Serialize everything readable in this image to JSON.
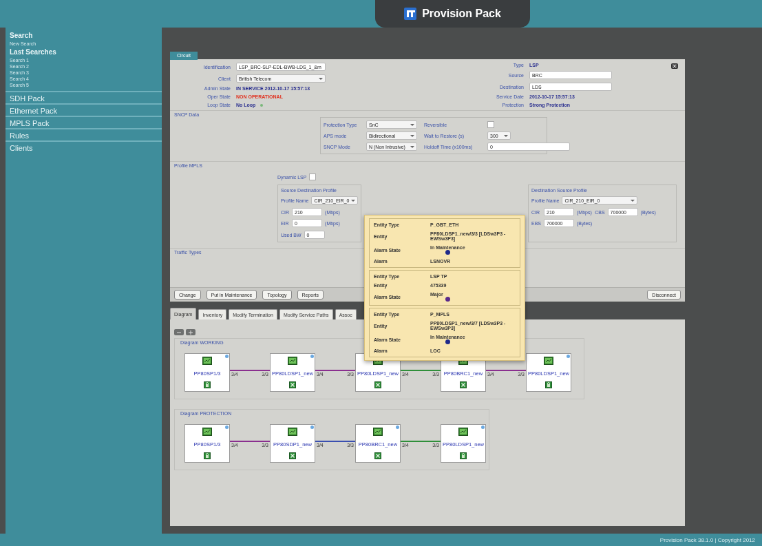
{
  "header": {
    "title": "Provision Pack"
  },
  "sidebar": {
    "items": [
      {
        "label": "Search",
        "kind": "heading"
      },
      {
        "label": "New Search",
        "kind": "link"
      },
      {
        "label": "Last Searches",
        "kind": "heading"
      },
      {
        "label": "Search 1",
        "kind": "link"
      },
      {
        "label": "Search 2",
        "kind": "link"
      },
      {
        "label": "Search 3",
        "kind": "link"
      },
      {
        "label": "Search 4",
        "kind": "link"
      },
      {
        "label": "Search 5",
        "kind": "link"
      },
      {
        "label": "SDH Pack",
        "kind": "section"
      },
      {
        "label": "Ethernet Pack",
        "kind": "section"
      },
      {
        "label": "MPLS Pack",
        "kind": "section"
      },
      {
        "label": "Rules",
        "kind": "section"
      },
      {
        "label": "Clients",
        "kind": "section"
      }
    ]
  },
  "circuit": {
    "tab": "Circuit",
    "left_fields": [
      {
        "label": "Identification",
        "kind": "input",
        "value": "LSP_BRC-SLP-EDL-BWB-LDS_1_&m"
      },
      {
        "label": "Client",
        "kind": "select",
        "value": "British Telecom"
      },
      {
        "label": "Admin State",
        "kind": "text",
        "value": "IN SERVICE 2012-10-17 15:57:13"
      },
      {
        "label": "Oper State",
        "kind": "alert",
        "value": "NON OPERATIONAL"
      },
      {
        "label": "Loop State",
        "kind": "text_icon",
        "value": "No Loop"
      }
    ],
    "right_fields": [
      {
        "label": "Type",
        "kind": "text",
        "value": "LSP"
      },
      {
        "label": "Source",
        "kind": "input",
        "value": "BRC"
      },
      {
        "label": "Destination",
        "kind": "input",
        "value": "LDS"
      },
      {
        "label": "Service Date",
        "kind": "text",
        "value": "2012-10-17 15:57:13"
      },
      {
        "label": "Protection",
        "kind": "text",
        "value": "Strong Protection"
      }
    ],
    "sncp": {
      "title": "SNCP Data",
      "fields": [
        {
          "label": "Protection Type",
          "kind": "select",
          "value": "SnC"
        },
        {
          "label": "Reversible",
          "kind": "checkbox",
          "checked": false
        },
        {
          "label": "APS mode",
          "kind": "select",
          "value": "Bidirectional"
        },
        {
          "label": "Wait to Restore (s)",
          "kind": "select",
          "value": "300"
        },
        {
          "label": "SNCP Mode",
          "kind": "select",
          "value": "N (Non Intrusive)"
        },
        {
          "label": "Holdoff Time (x100ms)",
          "kind": "input",
          "value": "0"
        }
      ]
    },
    "profile": {
      "title": "Profile MPLS",
      "dynamic_lsp": {
        "label": "Dynamic LSP",
        "checked": false
      },
      "source": {
        "title": "Source Destination Profile",
        "profile_label": "Profile Name",
        "profile_value": "CIR_210_EIR_0",
        "rows": [
          {
            "label": "CIR",
            "value": "210",
            "unit": "(Mbps)"
          },
          {
            "label": "EIR",
            "value": "0",
            "unit": "(Mbps)"
          }
        ],
        "used_bw": {
          "label": "Used BW",
          "value": "0"
        }
      },
      "destination": {
        "title": "Destination Source Profile",
        "profile_label": "Profile Name",
        "profile_value": "CIR_210_EIR_0",
        "rows": [
          {
            "label": "CIR",
            "value": "210",
            "unit": "(Mbps)"
          },
          {
            "label": "CBS",
            "value": "700000",
            "unit": "(Bytes)"
          },
          {
            "label": "EBS",
            "value": "700000",
            "unit": "(Bytes)"
          }
        ]
      }
    },
    "traffic": {
      "title": "Traffic Types"
    },
    "buttons": [
      "Change",
      "Put in Maintenance",
      "Topology",
      "Reports"
    ],
    "disconnect": "Disconnect"
  },
  "tabs": [
    {
      "label": "Diagram",
      "selected": true
    },
    {
      "label": "Inventory",
      "selected": false
    },
    {
      "label": "Modify Termination",
      "selected": false
    },
    {
      "label": "Modify Service Paths",
      "selected": false
    },
    {
      "label": "Assoc",
      "selected": false
    }
  ],
  "diagram": {
    "groups": [
      {
        "title": "Diagram WORKING",
        "nodes": [
          {
            "label": "PP80SP1/3",
            "kind": "locked"
          },
          {
            "label": "PP80LDSP1_new",
            "kind": "crossed"
          },
          {
            "label": "PP80LDSP1_new",
            "kind": "crossed"
          },
          {
            "label": "PP80BRC1_new",
            "kind": "crossed"
          },
          {
            "label": "PP80LDSP1_new",
            "kind": "locked"
          }
        ],
        "links": [
          {
            "color": "#8a2f8f",
            "from_port": "3/4",
            "to_port": "3/3"
          },
          {
            "color": "#8a2f8f",
            "from_port": "3/4",
            "to_port": "3/3"
          },
          {
            "color": "#2f8f3a",
            "from_port": "3/4",
            "to_port": "3/3"
          },
          {
            "color": "#8a2f8f",
            "from_port": "3/4",
            "to_port": "3/3"
          }
        ]
      },
      {
        "title": "Diagram PROTECTION",
        "nodes": [
          {
            "label": "PP80SP1/3",
            "kind": "locked"
          },
          {
            "label": "PP80SDP1_new",
            "kind": "crossed"
          },
          {
            "label": "PP80BRC1_new",
            "kind": "crossed"
          },
          {
            "label": "PP80LDSP1_new",
            "kind": "locked"
          }
        ],
        "links": [
          {
            "color": "#8a2f8f",
            "from_port": "3/4",
            "to_port": "3/3"
          },
          {
            "color": "#3a4fb0",
            "from_port": "3/4",
            "to_port": "3/3"
          },
          {
            "color": "#2f8f3a",
            "from_port": "3/4",
            "to_port": "3/3"
          }
        ]
      }
    ]
  },
  "tooltip": {
    "sections": [
      {
        "rows": [
          {
            "label": "Entity Type",
            "value": "P_GBT_ETH"
          },
          {
            "label": "Entity",
            "value": "PP80LDSP1_new/3/3 [LDSw3P3 - EWSw3P3]"
          },
          {
            "label": "Alarm State",
            "value": "In Maintenance",
            "color": "#1f2a8a"
          },
          {
            "label": "Alarm",
            "value": "LSNOVR"
          }
        ]
      },
      {
        "rows": [
          {
            "label": "Entity Type",
            "value": "LSP TP"
          },
          {
            "label": "Entity",
            "value": "475339"
          },
          {
            "label": "Alarm State",
            "value": "Major",
            "color": "#5a2a8a"
          }
        ]
      },
      {
        "rows": [
          {
            "label": "Entity Type",
            "value": "P_MPLS"
          },
          {
            "label": "Entity",
            "value": "PP80LDSP1_new/3/7 [LDSw3P3 - EWSw3P3]"
          },
          {
            "label": "Alarm State",
            "value": "In Maintenance",
            "color": "#1f2a8a"
          },
          {
            "label": "Alarm",
            "value": "LOC"
          }
        ]
      }
    ]
  },
  "footer": {
    "text": "Provision Pack 38.1.0 | Copyright 2012"
  }
}
